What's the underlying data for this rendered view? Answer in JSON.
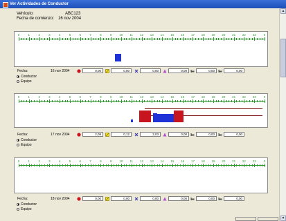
{
  "window": {
    "title": "Ver Actividades de Conductor"
  },
  "header": {
    "vehicle_label": "Vehículo:",
    "vehicle_value": "ABC123",
    "start_label": "Fecha de comienzo:",
    "start_value": "16 nov 2004"
  },
  "timeline": {
    "hours": [
      "0",
      "1",
      "2",
      "3",
      "4",
      "5",
      "6",
      "7",
      "8",
      "9",
      "10",
      "11",
      "12",
      "13",
      "14",
      "15",
      "16",
      "17",
      "18",
      "19",
      "20",
      "21",
      "22",
      "23",
      "0"
    ]
  },
  "days": [
    {
      "fecha_label": "Fecha:",
      "fecha": "16 nov 2004",
      "values": [
        "0,00",
        "0,00",
        "0,00",
        "0,00",
        "0,00",
        "0,00"
      ],
      "options": [
        "Conductor",
        "Equipo"
      ],
      "selected_option": "Conductor"
    },
    {
      "fecha_label": "Fecha:",
      "fecha": "17 nov 2004",
      "values": [
        "2,08",
        "0,12",
        "2,03",
        "0,00",
        "0,00",
        "0,00"
      ],
      "options": [
        "Conductor",
        "Equipo"
      ],
      "selected_option": "Conductor"
    },
    {
      "fecha_label": "Fecha:",
      "fecha": "18 nov 2004",
      "values": [
        "0,00",
        "0,00",
        "0,00",
        "0,00",
        "0,00",
        "0,00"
      ],
      "options": [
        "Conductor",
        "Equipo"
      ],
      "selected_option": "Conductor"
    }
  ],
  "activity_icons": [
    "driving-icon",
    "rest-icon",
    "work-icon",
    "availability-icon",
    "bed-icon",
    "bed2-icon"
  ],
  "colors": {
    "driving": "#c8141e",
    "work": "#1e32d8",
    "ruler": "#2a9a2a",
    "title": "#1d4fb8"
  }
}
